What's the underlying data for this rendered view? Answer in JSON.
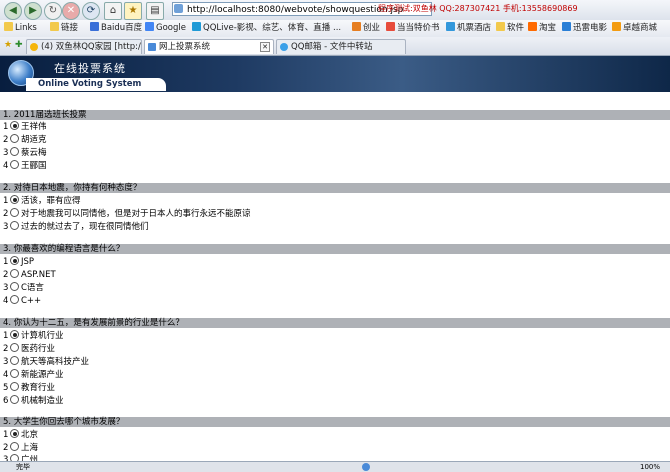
{
  "browser": {
    "address": "http://localhost:8080/webvote/showquestion.jsp",
    "dev_info": "程序测试:双鱼林  QQ:287307421  手机:13558690869",
    "links": [
      "Links",
      "链接",
      "Baidu百度",
      "Google",
      "QQLive-影视、综艺、体育、直播 ...",
      "创业",
      "当当特价书",
      "机票酒店",
      "软件",
      "淘宝",
      "迅雷电影",
      "卓越商城"
    ],
    "tabs": [
      "(4) 双鱼林QQ家园 [http://28...",
      "网上投票系统",
      "QQ邮箱 - 文件中转站"
    ]
  },
  "banner": {
    "title": "在线投票系统",
    "subtitle": "Online Voting System"
  },
  "questions": [
    {
      "title": "1. 2011届选班长投票",
      "options": [
        "王祥伟",
        "胡适克",
        "蔡云梅",
        "王郦国"
      ]
    },
    {
      "title": "2. 对待日本地震，你持有何种态度？",
      "options": [
        "活该，罪有应得",
        "对于地震我可以同情他，但是对于日本人的事行永远不能原谅",
        "过去的就过去了，现在很同情他们"
      ]
    },
    {
      "title": "3. 你最喜欢的编程语言是什么？",
      "options": [
        "JSP",
        "ASP.NET",
        "C语言",
        "C++"
      ]
    },
    {
      "title": "4. 你认为十二五，是有发展前景的行业是什么？",
      "options": [
        "计算机行业",
        "医药行业",
        "航天等高科技产业",
        "新能源产业",
        "教育行业",
        "机械制造业"
      ]
    },
    {
      "title": "5. 大学生你回去哪个城市发展？",
      "options": [
        "北京",
        "上海",
        "广州"
      ]
    }
  ],
  "status": {
    "left": "完毕",
    "zoom": "100%"
  }
}
